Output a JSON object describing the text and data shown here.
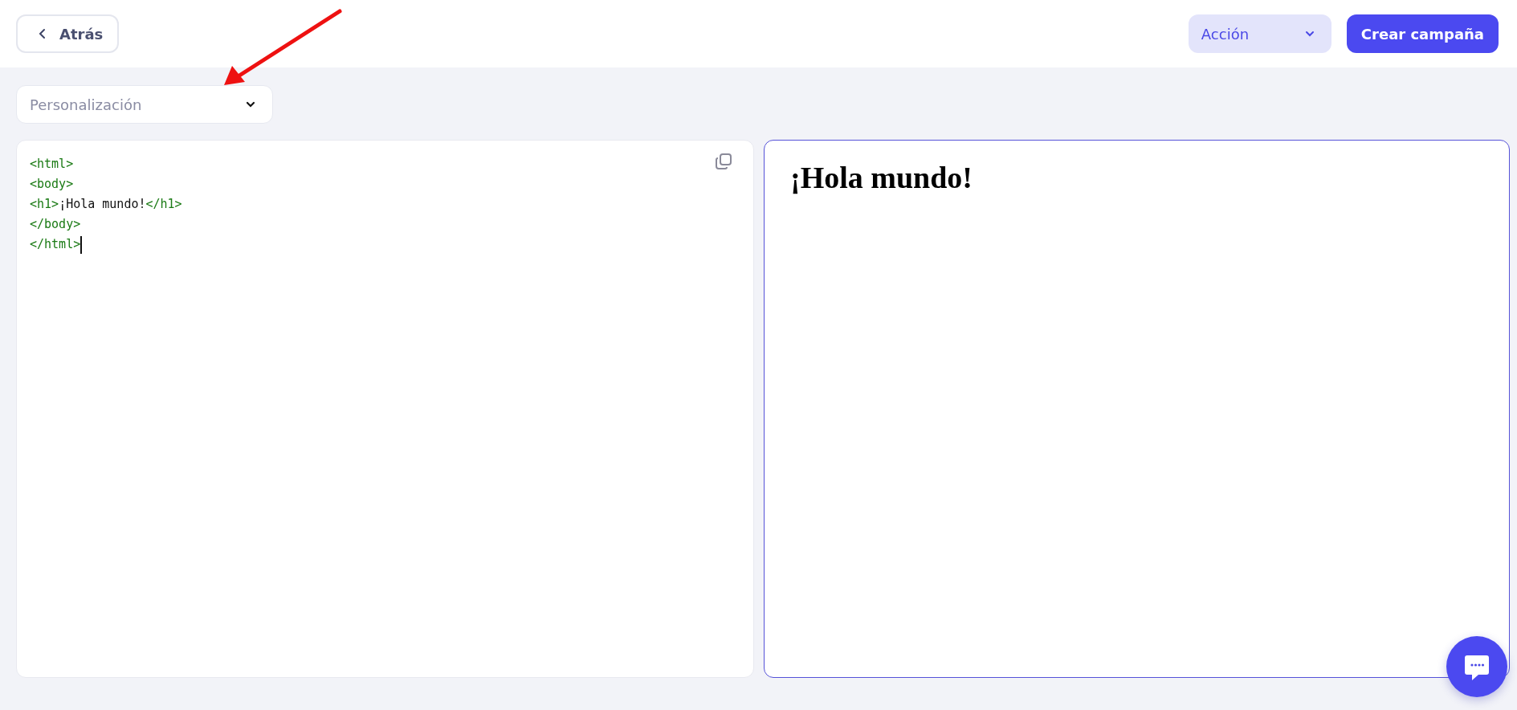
{
  "header": {
    "back_button": "Atrás",
    "action_menu": "Acción",
    "primary_button": "Crear campaña"
  },
  "dropdown": {
    "value": "Personalización"
  },
  "editor": {
    "caret": true,
    "lines": [
      [
        {
          "kind": "tag",
          "text": "<html>"
        }
      ],
      [
        {
          "kind": "tag",
          "text": "<body>"
        }
      ],
      [
        {
          "kind": "tag",
          "text": "<h1>"
        },
        {
          "kind": "text",
          "text": "¡Hola mundo!"
        },
        {
          "kind": "tag",
          "text": "</h1>"
        }
      ],
      [
        {
          "kind": "tag",
          "text": "</body>"
        }
      ],
      [
        {
          "kind": "tag",
          "text": "</html>"
        }
      ]
    ]
  },
  "preview": {
    "heading": "¡Hola mundo!"
  }
}
